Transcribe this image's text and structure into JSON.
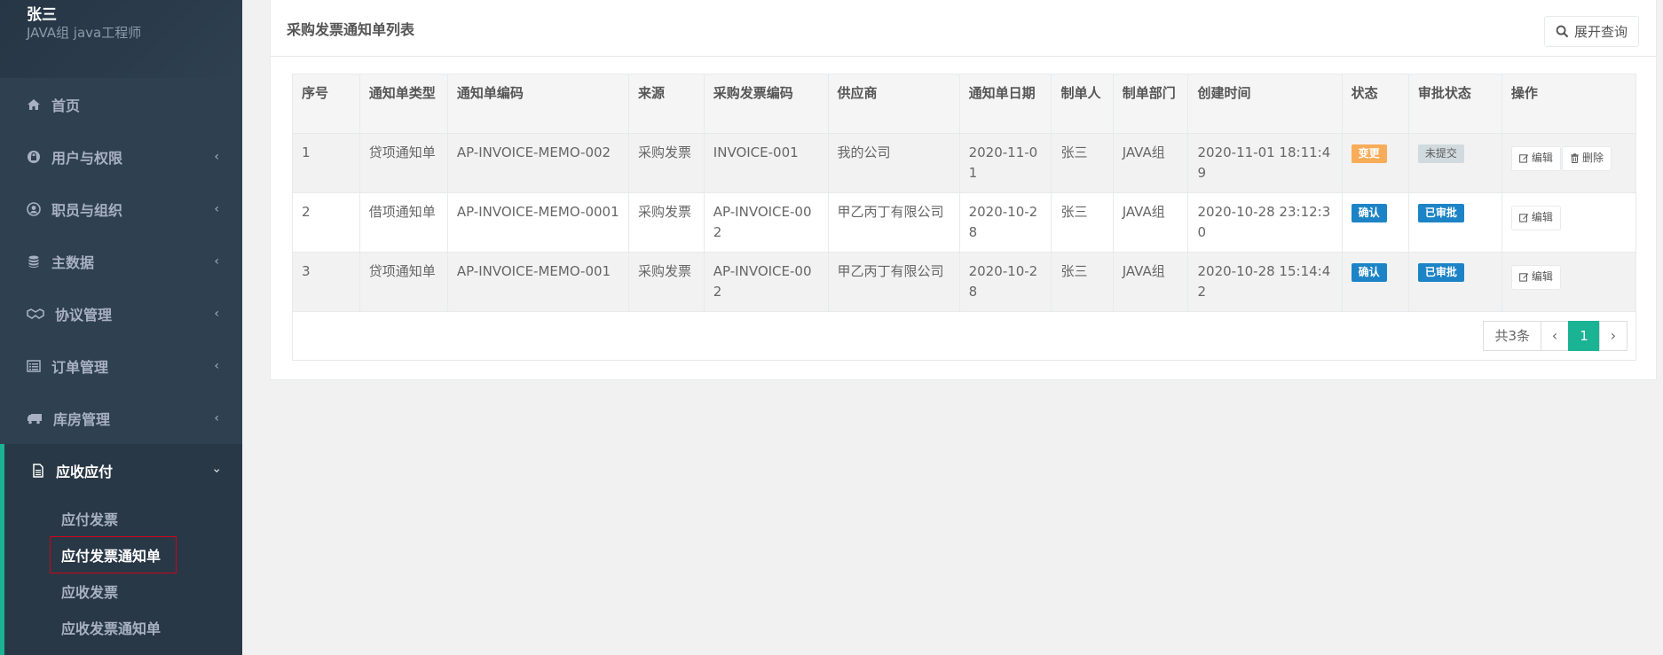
{
  "profile": {
    "name": "张三",
    "role": "JAVA组  java工程师"
  },
  "sidebar": {
    "items": [
      {
        "label": "首页",
        "icon": "home-icon",
        "has_children": false
      },
      {
        "label": "用户与权限",
        "icon": "lock-icon",
        "has_children": true
      },
      {
        "label": "职员与组织",
        "icon": "user-circle-icon",
        "has_children": true
      },
      {
        "label": "主数据",
        "icon": "database-icon",
        "has_children": true
      },
      {
        "label": "协议管理",
        "icon": "handshake-icon",
        "has_children": true
      },
      {
        "label": "订单管理",
        "icon": "list-alt-icon",
        "has_children": true
      },
      {
        "label": "库房管理",
        "icon": "truck-icon",
        "has_children": true
      },
      {
        "label": "应收应付",
        "icon": "file-icon",
        "has_children": true,
        "expanded": true
      }
    ],
    "subitems": [
      {
        "label": "应付发票"
      },
      {
        "label": "应付发票通知单",
        "current": true
      },
      {
        "label": "应收发票"
      },
      {
        "label": "应收发票通知单"
      }
    ]
  },
  "panel": {
    "title": "采购发票通知单列表",
    "expand_label": "展开查询"
  },
  "table": {
    "headers": [
      "序号",
      "通知单类型",
      "通知单编码",
      "来源",
      "采购发票编码",
      "供应商",
      "通知单日期",
      "制单人",
      "制单部门",
      "创建时间",
      "状态",
      "审批状态",
      "操作"
    ],
    "rows": [
      {
        "seq": "1",
        "type": "贷项通知单",
        "code": "AP-INVOICE-MEMO-002",
        "source": "采购发票",
        "invoice_code": "INVOICE-001",
        "supplier": "我的公司",
        "date": "2020-11-01",
        "maker": "张三",
        "dept": "JAVA组",
        "created": "2020-11-01 18:11:49",
        "status": "变更",
        "status_color": "#f8ac59",
        "approval": "未提交",
        "approval_style": "grey",
        "actions": [
          "编辑",
          "删除"
        ]
      },
      {
        "seq": "2",
        "type": "借项通知单",
        "code": "AP-INVOICE-MEMO-0001",
        "source": "采购发票",
        "invoice_code": "AP-INVOICE-002",
        "supplier": "甲乙丙丁有限公司",
        "date": "2020-10-28",
        "maker": "张三",
        "dept": "JAVA组",
        "created": "2020-10-28 23:12:30",
        "status": "确认",
        "status_color": "#1c84c6",
        "approval": "已审批",
        "approval_style": "blue",
        "actions": [
          "编辑"
        ]
      },
      {
        "seq": "3",
        "type": "贷项通知单",
        "code": "AP-INVOICE-MEMO-001",
        "source": "采购发票",
        "invoice_code": "AP-INVOICE-002",
        "supplier": "甲乙丙丁有限公司",
        "date": "2020-10-28",
        "maker": "张三",
        "dept": "JAVA组",
        "created": "2020-10-28 15:14:42",
        "status": "确认",
        "status_color": "#1c84c6",
        "approval": "已审批",
        "approval_style": "blue",
        "actions": [
          "编辑"
        ]
      }
    ]
  },
  "pagination": {
    "total": "共3条",
    "current_page": "1",
    "prev": "‹",
    "next": "›"
  },
  "colors": {
    "sidebar_bg": "#2f4050",
    "accent": "#1ab394",
    "highlight_box": "#d0021b"
  }
}
